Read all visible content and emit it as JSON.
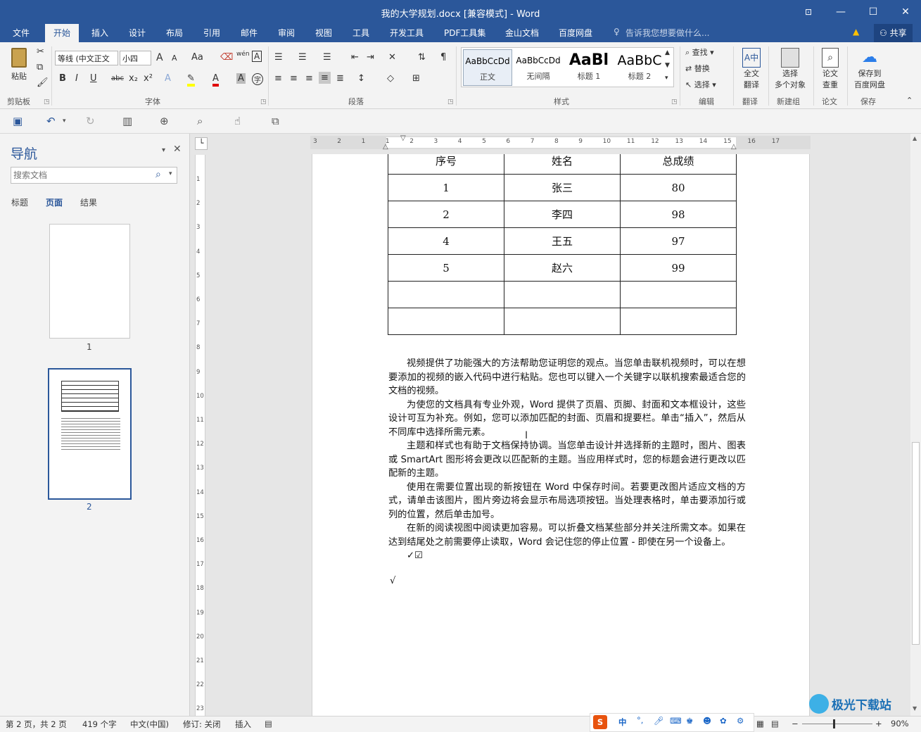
{
  "window": {
    "title": "我的大学规划.docx [兼容模式] - Word"
  },
  "menu": {
    "tabs": [
      "文件",
      "开始",
      "插入",
      "设计",
      "布局",
      "引用",
      "邮件",
      "审阅",
      "视图",
      "工具",
      "开发工具",
      "PDF工具集",
      "金山文档",
      "百度网盘"
    ],
    "active": "开始",
    "tellme": "告诉我您想要做什么...",
    "share": "共享"
  },
  "ribbon": {
    "clipboard": {
      "paste": "粘贴",
      "label": "剪贴板"
    },
    "font": {
      "name": "等线 (中文正文",
      "size": "小四",
      "label": "字体",
      "aa": "Aa",
      "wen": "wén",
      "a_big": "A",
      "a_small": "A",
      "bold": "B",
      "italic": "I",
      "underline": "U",
      "strike": "abc",
      "sub": "x₂",
      "sup": "x²",
      "a_effect": "A",
      "a_color": "A",
      "a_shade": "A",
      "circle": "字"
    },
    "paragraph": {
      "label": "段落"
    },
    "styles": {
      "label": "样式",
      "items": [
        {
          "sample": "AaBbCcDd",
          "name": "正文"
        },
        {
          "sample": "AaBbCcDd",
          "name": "无间隔"
        },
        {
          "sample": "AaBl",
          "name": "标题 1"
        },
        {
          "sample": "AaBbC",
          "name": "标题 2"
        }
      ]
    },
    "editing": {
      "find": "查找",
      "replace": "替换",
      "select": "选择",
      "label": "编辑"
    },
    "translate": {
      "btn1": "全文",
      "btn2": "翻译",
      "label": "翻译"
    },
    "newgroup": {
      "btn1": "选择",
      "btn2": "多个对象",
      "label": "新建组"
    },
    "paper": {
      "btn1": "论文",
      "btn2": "查重",
      "label": "论文"
    },
    "save": {
      "btn1": "保存到",
      "btn2": "百度网盘",
      "label": "保存"
    }
  },
  "nav": {
    "title": "导航",
    "search_placeholder": "搜索文档",
    "tabs": [
      "标题",
      "页面",
      "结果"
    ],
    "active_tab": "页面",
    "pages": [
      "1",
      "2"
    ]
  },
  "hruler_labels": [
    "3",
    "2",
    "1",
    "1",
    "2",
    "3",
    "4",
    "5",
    "6",
    "7",
    "8",
    "9",
    "10",
    "11",
    "12",
    "13",
    "14",
    "15",
    "16",
    "17"
  ],
  "vruler_labels": [
    "1",
    "2",
    "3",
    "4",
    "5",
    "6",
    "7",
    "8",
    "9",
    "10",
    "11",
    "12",
    "13",
    "14",
    "15",
    "16",
    "17",
    "18",
    "19",
    "20",
    "21",
    "22",
    "23"
  ],
  "document": {
    "table_header": [
      "序号",
      "姓名",
      "总成绩"
    ],
    "table_rows": [
      [
        "1",
        "张三",
        "80"
      ],
      [
        "2",
        "李四",
        "98"
      ],
      [
        "4",
        "王五",
        "97"
      ],
      [
        "5",
        "赵六",
        "99"
      ],
      [
        "",
        "",
        ""
      ],
      [
        "",
        "",
        ""
      ]
    ],
    "paragraphs": [
      "视频提供了功能强大的方法帮助您证明您的观点。当您单击联机视频时，可以在想要添加的视频的嵌入代码中进行粘贴。您也可以键入一个关键字以联机搜索最适合您的文档的视频。",
      "为使您的文档具有专业外观，Word 提供了页眉、页脚、封面和文本框设计，这些设计可互为补充。例如，您可以添加匹配的封面、页眉和提要栏。单击“插入”，然后从不同库中选择所需元素。",
      "主题和样式也有助于文档保持协调。当您单击设计并选择新的主题时，图片、图表或 SmartArt 图形将会更改以匹配新的主题。当应用样式时，您的标题会进行更改以匹配新的主题。",
      "使用在需要位置出现的新按钮在 Word 中保存时间。若要更改图片适应文档的方式，请单击该图片，图片旁边将会显示布局选项按钮。当处理表格时，单击要添加行或列的位置，然后单击加号。",
      "在新的阅读视图中阅读更加容易。可以折叠文档某些部分并关注所需文本。如果在达到结尾处之前需要停止读取，Word 会记住您的停止位置 - 即使在另一个设备上。",
      "✓☑"
    ],
    "check_line": "√"
  },
  "status": {
    "page": "第 2 页，共 2 页",
    "words": "419 个字",
    "lang": "中文(中国)",
    "track": "修订: 关闭",
    "mode": "插入",
    "ime": "中",
    "zoom": "90%"
  },
  "watermark": "极光下载站"
}
